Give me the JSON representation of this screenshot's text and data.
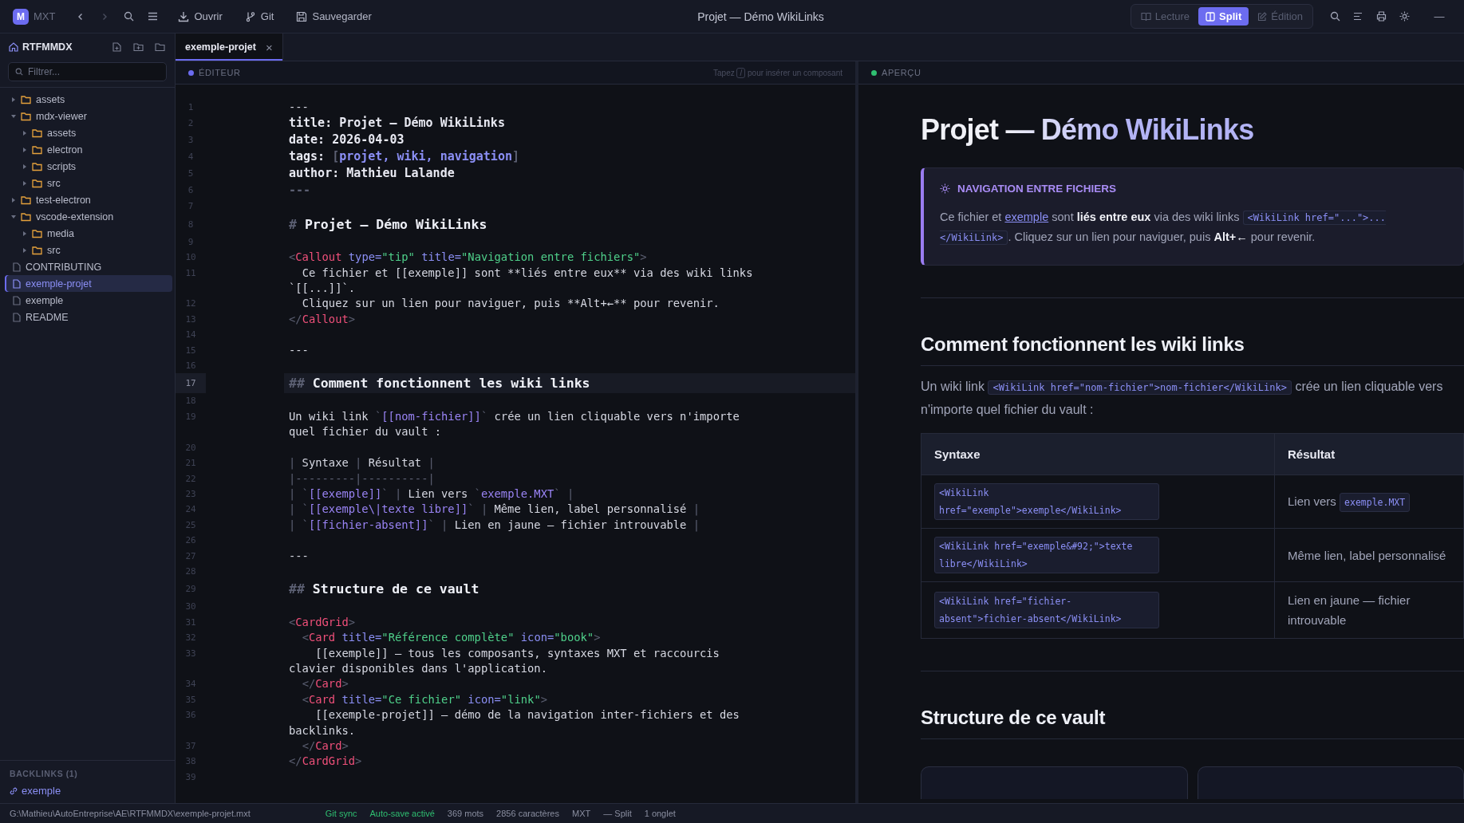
{
  "app": {
    "logo": "M",
    "name": "MXT"
  },
  "toolbar": [
    {
      "label": "Ouvrir"
    },
    {
      "label": "Git"
    },
    {
      "label": "Sauvegarder"
    }
  ],
  "window": {
    "title": "Projet — Démo WikiLinks"
  },
  "nav": {
    "back_disabled": false,
    "forward_disabled": true
  },
  "view_modes": [
    {
      "label": "Lecture",
      "selected": false
    },
    {
      "label": "Split",
      "selected": true
    },
    {
      "label": "Édition",
      "selected": false
    }
  ],
  "window_controls": {
    "minimize": "—"
  },
  "sidebar": {
    "title": "RTFMMDX",
    "filter": {
      "placeholder": "Filtrer..."
    },
    "items": [
      {
        "name": "assets",
        "kind": "folder",
        "expanded": false,
        "selected": false
      },
      {
        "name": "mdx-viewer",
        "kind": "folder",
        "expanded": true,
        "selected": false,
        "children": [
          {
            "name": "assets",
            "kind": "folder",
            "expanded": false,
            "selected": false
          },
          {
            "name": "electron",
            "kind": "folder",
            "expanded": false,
            "selected": false
          },
          {
            "name": "scripts",
            "kind": "folder",
            "expanded": false,
            "selected": false
          },
          {
            "name": "src",
            "kind": "folder",
            "expanded": false,
            "selected": false
          }
        ]
      },
      {
        "name": "test-electron",
        "kind": "folder",
        "expanded": false,
        "selected": false
      },
      {
        "name": "vscode-extension",
        "kind": "folder",
        "expanded": true,
        "selected": false,
        "children": [
          {
            "name": "media",
            "kind": "folder",
            "expanded": false,
            "selected": false
          },
          {
            "name": "src",
            "kind": "folder",
            "expanded": false,
            "selected": false
          }
        ]
      },
      {
        "name": "CONTRIBUTING",
        "kind": "file",
        "selected": false
      },
      {
        "name": "exemple-projet",
        "kind": "file",
        "selected": true
      },
      {
        "name": "exemple",
        "kind": "file",
        "selected": false
      },
      {
        "name": "README",
        "kind": "file",
        "selected": false
      }
    ],
    "backlinks": {
      "title": "BACKLINKS (1)",
      "items": [
        "exemple"
      ]
    }
  },
  "tabs": [
    {
      "label": "exemple-projet",
      "selected": true,
      "close": "×"
    }
  ],
  "editor": {
    "label": "ÉDITEUR",
    "hint_before": "Tapez",
    "hint_key": "/",
    "hint_after": "pour insérer un composant",
    "lines": [
      {
        "number": "1",
        "kind": "code",
        "highlighted": false,
        "tokens": [
          {
            "kind": "text",
            "text": "---"
          }
        ]
      },
      {
        "number": "2",
        "kind": "frontmatter",
        "highlighted": false,
        "tokens": [
          {
            "kind": "fm",
            "text": "title: Projet — Démo WikiLinks"
          }
        ]
      },
      {
        "number": "3",
        "kind": "frontmatter",
        "highlighted": false,
        "tokens": [
          {
            "kind": "fm",
            "text": "date: 2026-04-03"
          }
        ]
      },
      {
        "number": "4",
        "kind": "frontmatter",
        "highlighted": false,
        "tokens": [
          {
            "kind": "fm",
            "text": "tags: "
          },
          {
            "kind": "punct",
            "text": "["
          },
          {
            "kind": "fmlist",
            "text": "projet, wiki, navigation"
          },
          {
            "kind": "punct",
            "text": "]"
          }
        ]
      },
      {
        "number": "5",
        "kind": "frontmatter",
        "highlighted": false,
        "tokens": [
          {
            "kind": "fm",
            "text": "author: Mathieu Lalande"
          }
        ]
      },
      {
        "number": "6",
        "kind": "frontmatter",
        "highlighted": false,
        "tokens": [
          {
            "kind": "punct",
            "text": "---"
          }
        ]
      },
      {
        "number": "7",
        "kind": "code",
        "highlighted": false
      },
      {
        "number": "8",
        "kind": "heading",
        "highlighted": false,
        "tokens": [
          {
            "kind": "hash",
            "text": "# "
          },
          {
            "kind": "heading",
            "text": "Projet — Démo WikiLinks"
          }
        ]
      },
      {
        "number": "9",
        "kind": "code",
        "highlighted": false
      },
      {
        "number": "10",
        "kind": "code",
        "highlighted": false,
        "tokens": [
          {
            "kind": "punct",
            "text": "<"
          },
          {
            "kind": "tag",
            "text": "Callout"
          },
          {
            "kind": "attr",
            "text": " type="
          },
          {
            "kind": "string",
            "text": "\"tip\""
          },
          {
            "kind": "attr",
            "text": " title="
          },
          {
            "kind": "string",
            "text": "\"Navigation entre fichiers\""
          },
          {
            "kind": "punct",
            "text": ">"
          }
        ]
      },
      {
        "number": "11",
        "kind": "code",
        "highlighted": false,
        "tokens": [
          {
            "kind": "text",
            "text": "  Ce fichier et [[exemple]] sont **liés entre eux** via des wiki links `[[...]]`."
          }
        ]
      },
      {
        "number": "12",
        "kind": "code",
        "highlighted": false,
        "tokens": [
          {
            "kind": "text",
            "text": "  Cliquez sur un lien pour naviguer, puis **Alt+←** pour revenir."
          }
        ]
      },
      {
        "number": "13",
        "kind": "code",
        "highlighted": false,
        "tokens": [
          {
            "kind": "punct",
            "text": "</"
          },
          {
            "kind": "tag",
            "text": "Callout"
          },
          {
            "kind": "punct",
            "text": ">"
          }
        ]
      },
      {
        "number": "14",
        "kind": "code",
        "highlighted": false
      },
      {
        "number": "15",
        "kind": "code",
        "highlighted": false,
        "tokens": [
          {
            "kind": "text",
            "text": "---"
          }
        ]
      },
      {
        "number": "16",
        "kind": "code",
        "highlighted": false
      },
      {
        "number": "17",
        "kind": "heading",
        "highlighted": true,
        "tokens": [
          {
            "kind": "hash",
            "text": "## "
          },
          {
            "kind": "heading",
            "text": "Comment fonctionnent les wiki links"
          }
        ]
      },
      {
        "number": "18",
        "kind": "code",
        "highlighted": false
      },
      {
        "number": "19",
        "kind": "code",
        "highlighted": false,
        "tokens": [
          {
            "kind": "text",
            "text": "Un wiki link "
          },
          {
            "kind": "punct",
            "text": "`"
          },
          {
            "kind": "link",
            "text": "[[nom-fichier]]"
          },
          {
            "kind": "punct",
            "text": "`"
          },
          {
            "kind": "text",
            "text": " crée un lien cliquable vers n'importe quel fichier du vault :"
          }
        ]
      },
      {
        "number": "20",
        "kind": "code",
        "highlighted": false
      },
      {
        "number": "21",
        "kind": "code",
        "highlighted": false,
        "tokens": [
          {
            "kind": "punct",
            "text": "|"
          },
          {
            "kind": "text",
            "text": " Syntaxe "
          },
          {
            "kind": "punct",
            "text": "|"
          },
          {
            "kind": "text",
            "text": " Résultat "
          },
          {
            "kind": "punct",
            "text": "|"
          }
        ]
      },
      {
        "number": "22",
        "kind": "code",
        "highlighted": false,
        "tokens": [
          {
            "kind": "punct",
            "text": "|---------|----------|"
          }
        ]
      },
      {
        "number": "23",
        "kind": "code",
        "highlighted": false,
        "tokens": [
          {
            "kind": "punct",
            "text": "| `"
          },
          {
            "kind": "link",
            "text": "[[exemple]]"
          },
          {
            "kind": "punct",
            "text": "` |"
          },
          {
            "kind": "text",
            "text": " Lien vers "
          },
          {
            "kind": "punct",
            "text": "`"
          },
          {
            "kind": "link",
            "text": "exemple.MXT"
          },
          {
            "kind": "punct",
            "text": "` |"
          }
        ]
      },
      {
        "number": "24",
        "kind": "code",
        "highlighted": false,
        "tokens": [
          {
            "kind": "punct",
            "text": "| `"
          },
          {
            "kind": "link",
            "text": "[[exemple\\|texte libre]]"
          },
          {
            "kind": "punct",
            "text": "` |"
          },
          {
            "kind": "text",
            "text": " Même lien, label personnalisé "
          },
          {
            "kind": "punct",
            "text": "|"
          }
        ]
      },
      {
        "number": "25",
        "kind": "code",
        "highlighted": false,
        "tokens": [
          {
            "kind": "punct",
            "text": "| `"
          },
          {
            "kind": "link",
            "text": "[[fichier-absent]]"
          },
          {
            "kind": "punct",
            "text": "` |"
          },
          {
            "kind": "text",
            "text": " Lien en jaune — fichier introuvable "
          },
          {
            "kind": "punct",
            "text": "|"
          }
        ]
      },
      {
        "number": "26",
        "kind": "code",
        "highlighted": false
      },
      {
        "number": "27",
        "kind": "code",
        "highlighted": false,
        "tokens": [
          {
            "kind": "text",
            "text": "---"
          }
        ]
      },
      {
        "number": "28",
        "kind": "code",
        "highlighted": false
      },
      {
        "number": "29",
        "kind": "heading",
        "highlighted": false,
        "tokens": [
          {
            "kind": "hash",
            "text": "## "
          },
          {
            "kind": "heading",
            "text": "Structure de ce vault"
          }
        ]
      },
      {
        "number": "30",
        "kind": "code",
        "highlighted": false
      },
      {
        "number": "31",
        "kind": "code",
        "highlighted": false,
        "tokens": [
          {
            "kind": "punct",
            "text": "<"
          },
          {
            "kind": "tag",
            "text": "CardGrid"
          },
          {
            "kind": "punct",
            "text": ">"
          }
        ]
      },
      {
        "number": "32",
        "kind": "code",
        "highlighted": false,
        "tokens": [
          {
            "kind": "punct",
            "text": "  <"
          },
          {
            "kind": "tag",
            "text": "Card"
          },
          {
            "kind": "attr",
            "text": " title="
          },
          {
            "kind": "string",
            "text": "\"Référence complète\""
          },
          {
            "kind": "attr",
            "text": " icon="
          },
          {
            "kind": "string",
            "text": "\"book\""
          },
          {
            "kind": "punct",
            "text": ">"
          }
        ]
      },
      {
        "number": "33",
        "kind": "code",
        "highlighted": false,
        "tokens": [
          {
            "kind": "text",
            "text": "    [[exemple]] — tous les composants, syntaxes MXT et raccourcis clavier disponibles dans l'application."
          }
        ]
      },
      {
        "number": "34",
        "kind": "code",
        "highlighted": false,
        "tokens": [
          {
            "kind": "punct",
            "text": "  </"
          },
          {
            "kind": "tag",
            "text": "Card"
          },
          {
            "kind": "punct",
            "text": ">"
          }
        ]
      },
      {
        "number": "35",
        "kind": "code",
        "highlighted": false,
        "tokens": [
          {
            "kind": "punct",
            "text": "  <"
          },
          {
            "kind": "tag",
            "text": "Card"
          },
          {
            "kind": "attr",
            "text": " title="
          },
          {
            "kind": "string",
            "text": "\"Ce fichier\""
          },
          {
            "kind": "attr",
            "text": " icon="
          },
          {
            "kind": "string",
            "text": "\"link\""
          },
          {
            "kind": "punct",
            "text": ">"
          }
        ]
      },
      {
        "number": "36",
        "kind": "code",
        "highlighted": false,
        "tokens": [
          {
            "kind": "text",
            "text": "    [[exemple-projet]] — démo de la navigation inter-fichiers et des backlinks."
          }
        ]
      },
      {
        "number": "37",
        "kind": "code",
        "highlighted": false,
        "tokens": [
          {
            "kind": "punct",
            "text": "  </"
          },
          {
            "kind": "tag",
            "text": "Card"
          },
          {
            "kind": "punct",
            "text": ">"
          }
        ]
      },
      {
        "number": "38",
        "kind": "code",
        "highlighted": false,
        "tokens": [
          {
            "kind": "punct",
            "text": "</"
          },
          {
            "kind": "tag",
            "text": "CardGrid"
          },
          {
            "kind": "punct",
            "text": ">"
          }
        ]
      },
      {
        "number": "39",
        "kind": "code",
        "highlighted": false
      }
    ]
  },
  "preview": {
    "label": "APERÇU",
    "title": "Projet — Démo WikiLinks",
    "blocks": [
      {
        "kind": "callout",
        "title": "NAVIGATION ENTRE FICHIERS",
        "segments": [
          {
            "kind": "text",
            "text": "Ce fichier et "
          },
          {
            "kind": "link",
            "text": "exemple"
          },
          {
            "kind": "text",
            "text": " sont "
          },
          {
            "kind": "bold",
            "text": "liés entre eux"
          },
          {
            "kind": "text",
            "text": " via des wiki links "
          },
          {
            "kind": "code",
            "text": "<WikiLink href=\"...\">...</WikiLink>"
          },
          {
            "kind": "text",
            "text": ". Cliquez sur un lien pour naviguer, puis "
          },
          {
            "kind": "bold",
            "text": "Alt+←"
          },
          {
            "kind": "text",
            "text": " pour revenir."
          }
        ]
      },
      {
        "kind": "rule"
      },
      {
        "kind": "heading",
        "text": "Comment fonctionnent les wiki links"
      },
      {
        "kind": "paragraph",
        "segments": [
          {
            "kind": "text",
            "text": "Un wiki link "
          },
          {
            "kind": "code",
            "text": "<WikiLink href=\"nom-fichier\">nom-fichier</WikiLink>"
          },
          {
            "kind": "text",
            "text": " crée un lien cliquable vers n'importe quel fichier du vault :"
          }
        ]
      },
      {
        "kind": "table",
        "columns": [
          "Syntaxe",
          "Résultat"
        ],
        "rows": [
          [
            [
              {
                "kind": "code",
                "text": "<WikiLink href=\"exemple\">exemple</WikiLink>"
              }
            ],
            [
              {
                "kind": "text",
                "text": "Lien vers "
              },
              {
                "kind": "code",
                "text": "exemple.MXT"
              }
            ]
          ],
          [
            [
              {
                "kind": "code",
                "text": "<WikiLink href=\"exemple&#92;\">texte libre</WikiLink>"
              }
            ],
            [
              {
                "kind": "text",
                "text": "Même lien, label personnalisé"
              }
            ]
          ],
          [
            [
              {
                "kind": "code",
                "text": "<WikiLink href=\"fichier-absent\">fichier-absent</WikiLink>"
              }
            ],
            [
              {
                "kind": "text",
                "text": "Lien en jaune — fichier introuvable"
              }
            ]
          ]
        ]
      },
      {
        "kind": "rule"
      },
      {
        "kind": "heading",
        "text": "Structure de ce vault"
      },
      {
        "kind": "cards",
        "items": [
          {
            "kind": "card"
          },
          {
            "kind": "card"
          }
        ]
      }
    ]
  },
  "status_bar": {
    "path": "G:\\Mathieu\\AutoEntreprise\\AE\\RTFMMDX\\exemple-projet.mxt",
    "items": [
      {
        "text": "Git sync",
        "kind": "ok"
      },
      {
        "text": "Auto-save activé",
        "kind": "ok"
      },
      {
        "text": "369 mots",
        "kind": "info"
      },
      {
        "text": "2856 caractères",
        "kind": "info"
      },
      {
        "text": "MXT",
        "kind": "info"
      },
      {
        "text": "— Split",
        "kind": "info"
      },
      {
        "text": "1 onglet",
        "kind": "info"
      }
    ]
  }
}
